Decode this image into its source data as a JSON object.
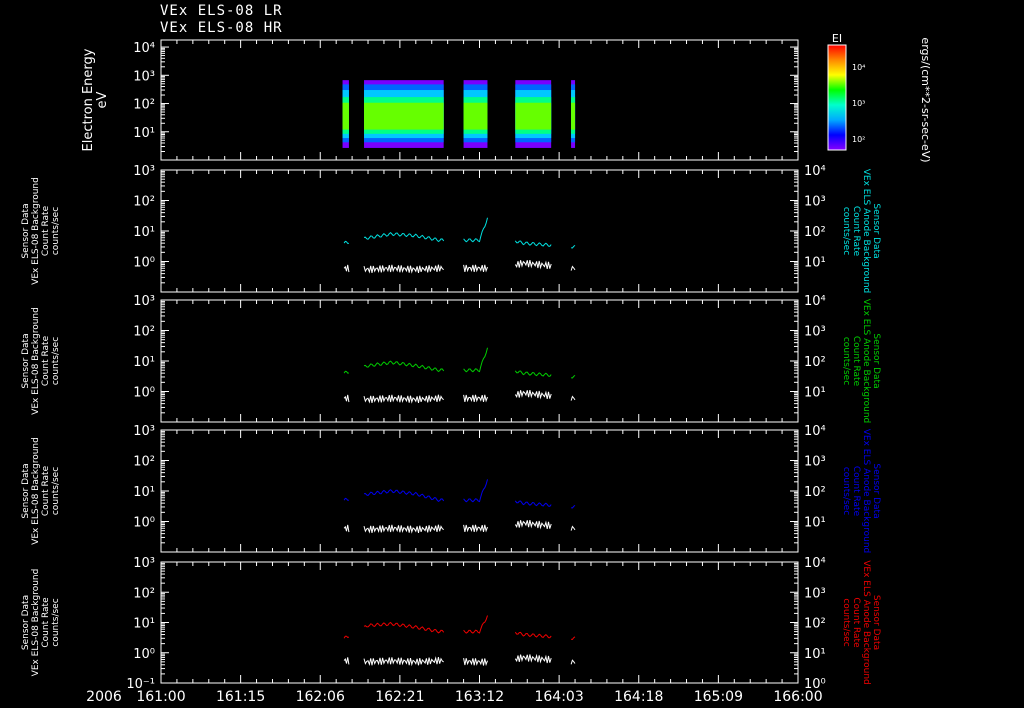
{
  "header": {
    "line1": "VEx ELS-08 LR",
    "line2": "VEx ELS-08 HR"
  },
  "colorbar": {
    "title": "EI",
    "units": "ergs/(cm**2-sr-sec-eV)",
    "ticks": [
      "10⁴",
      "10³",
      "10²"
    ],
    "colors": [
      "#ff0000",
      "#ff8800",
      "#ffff00",
      "#00ff00",
      "#00ffcc",
      "#00aaff",
      "#0000ff",
      "#8800ff"
    ]
  },
  "x_axis": {
    "year_label": "2006",
    "tick_labels": [
      "161:00",
      "161:15",
      "162:06",
      "162:21",
      "163:12",
      "164:03",
      "164:18",
      "165:09",
      "166:00"
    ]
  },
  "chart_data": [
    {
      "type": "heatmap",
      "name": "VEx ELS-08 LR / HR spectrogram",
      "ylabel": [
        "Electron Energy",
        "eV"
      ],
      "ytick_labels": [
        "10⁴",
        "10³",
        "10²",
        "10¹"
      ],
      "scale": "log",
      "data_intervals": [
        [
          2.28,
          2.36
        ],
        [
          2.55,
          3.55
        ],
        [
          3.8,
          4.1
        ],
        [
          4.45,
          4.9
        ],
        [
          5.15,
          5.2
        ]
      ],
      "energy_band_eV": [
        3,
        600
      ]
    },
    {
      "type": "line",
      "left_label": [
        "Sensor Data",
        "VEx ELS-08 Background",
        "Count Rate",
        "counts/sec"
      ],
      "right_label": [
        "Sensor Data",
        "VEx ELS Anode Background",
        "Count Rate",
        "counts/sec"
      ],
      "left_ticks": [
        "10³",
        "10²",
        "10¹",
        "10⁰",
        ""
      ],
      "right_ticks": [
        "10⁴",
        "10³",
        "10²",
        "10¹",
        ""
      ],
      "series_colors": [
        "#00e0e0",
        "#ffffff"
      ],
      "x": [
        2.3,
        2.6,
        2.9,
        3.2,
        3.5,
        4.0,
        4.15,
        4.3,
        4.55,
        5.2
      ],
      "series": [
        {
          "values": [
            4,
            6,
            8,
            7,
            5,
            5,
            60,
            6,
            4,
            3
          ]
        },
        {
          "values": [
            0.6,
            0.55,
            0.6,
            0.55,
            0.6,
            0.6,
            0.6,
            0.6,
            0.9,
            0.6
          ]
        }
      ]
    },
    {
      "type": "line",
      "left_label": [
        "Sensor Data",
        "VEx ELS-08 Background",
        "Count Rate",
        "counts/sec"
      ],
      "right_label": [
        "Sensor Data",
        "VEx ELS Anode Background",
        "Count Rate",
        "counts/sec"
      ],
      "left_ticks": [
        "10³",
        "10²",
        "10¹",
        "10⁰",
        ""
      ],
      "right_ticks": [
        "10⁴",
        "10³",
        "10²",
        "10¹",
        ""
      ],
      "series_colors": [
        "#00cc00",
        "#ffffff"
      ],
      "x": [
        2.3,
        2.6,
        2.9,
        3.2,
        3.5,
        4.0,
        4.15,
        4.3,
        4.55,
        5.2
      ],
      "series": [
        {
          "values": [
            4,
            7,
            9,
            7,
            5,
            5,
            60,
            6,
            4,
            3
          ]
        },
        {
          "values": [
            0.6,
            0.55,
            0.6,
            0.55,
            0.6,
            0.6,
            0.6,
            0.6,
            0.9,
            0.6
          ]
        }
      ]
    },
    {
      "type": "line",
      "left_label": [
        "Sensor Data",
        "VEx ELS-08 Background",
        "Count Rate",
        "counts/sec"
      ],
      "right_label": [
        "Sensor Data",
        "VEx ELS Anode Background",
        "Count Rate",
        "counts/sec"
      ],
      "left_ticks": [
        "10³",
        "10²",
        "10¹",
        "10⁰",
        ""
      ],
      "right_ticks": [
        "10⁴",
        "10³",
        "10²",
        "10¹",
        ""
      ],
      "series_colors": [
        "#0000ee",
        "#ffffff"
      ],
      "x": [
        2.3,
        2.6,
        2.9,
        3.2,
        3.5,
        4.0,
        4.15,
        4.3,
        4.55,
        5.2
      ],
      "series": [
        {
          "values": [
            5,
            8,
            10,
            8,
            5,
            5,
            50,
            6,
            4,
            3
          ]
        },
        {
          "values": [
            0.6,
            0.55,
            0.6,
            0.55,
            0.6,
            0.6,
            0.6,
            0.6,
            0.9,
            0.6
          ]
        }
      ]
    },
    {
      "type": "line",
      "left_label": [
        "Sensor Data",
        "VEx ELS-08 Background",
        "Count Rate",
        "counts/sec"
      ],
      "right_label": [
        "Sensor Data",
        "VEx ELS Anode Background",
        "Count Rate",
        "counts/sec"
      ],
      "left_ticks": [
        "10³",
        "10²",
        "10¹",
        "10⁰",
        "10⁻¹"
      ],
      "right_ticks": [
        "10⁴",
        "10³",
        "10²",
        "10¹",
        "10⁰"
      ],
      "series_colors": [
        "#ee0000",
        "#ffffff"
      ],
      "x": [
        2.3,
        2.6,
        2.9,
        3.2,
        3.5,
        4.0,
        4.15,
        4.3,
        4.55,
        5.2
      ],
      "series": [
        {
          "values": [
            3,
            8,
            9,
            7,
            5,
            5,
            30,
            6,
            4,
            3
          ]
        },
        {
          "values": [
            0.55,
            0.5,
            0.55,
            0.5,
            0.55,
            0.5,
            0.5,
            0.5,
            0.7,
            0.5
          ]
        }
      ]
    }
  ]
}
